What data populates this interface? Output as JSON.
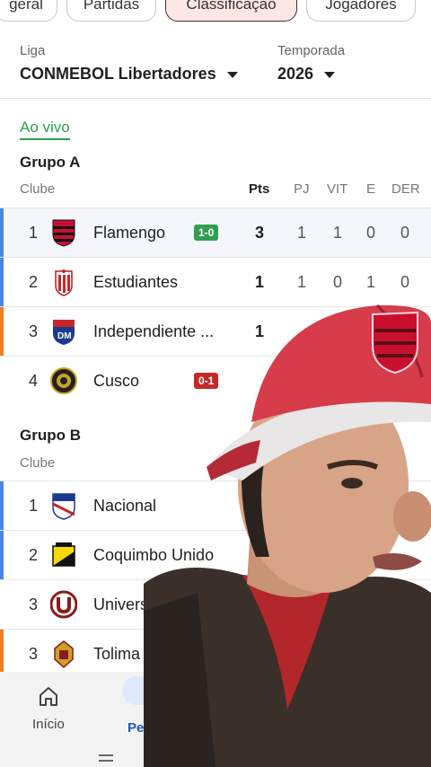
{
  "tabs": [
    {
      "label": "geral",
      "active": false
    },
    {
      "label": "Partidas",
      "active": false
    },
    {
      "label": "Classificação",
      "active": true
    },
    {
      "label": "Jogadores",
      "active": false
    }
  ],
  "filters": {
    "league_label": "Liga",
    "league_value": "CONMEBOL Libertadores",
    "season_label": "Temporada",
    "season_value": "2026"
  },
  "live_label": "Ao vivo",
  "columns": {
    "club": "Clube",
    "pts": "Pts",
    "pj": "PJ",
    "vit": "VIT",
    "e": "E",
    "der": "DER"
  },
  "groups": [
    {
      "title": "Grupo A",
      "rows": [
        {
          "pos": "1",
          "name": "Flamengo",
          "score": "1-0",
          "score_color": "#2e9f4e",
          "pts": "3",
          "pj": "1",
          "vit": "1",
          "e": "0",
          "der": "0",
          "bar": "#4a86e8"
        },
        {
          "pos": "2",
          "name": "Estudiantes",
          "score": "",
          "pts": "1",
          "pj": "1",
          "vit": "0",
          "e": "1",
          "der": "0",
          "bar": "#4a86e8"
        },
        {
          "pos": "3",
          "name": "Independiente ...",
          "score": "",
          "pts": "1",
          "pj": "",
          "vit": "",
          "e": "",
          "der": "",
          "bar": "#f07d22"
        },
        {
          "pos": "4",
          "name": "Cusco",
          "score": "0-1",
          "score_color": "#c62828",
          "pts": "",
          "pj": "",
          "vit": "",
          "e": "",
          "der": "",
          "bar": ""
        }
      ]
    },
    {
      "title": "Grupo B",
      "rows": [
        {
          "pos": "1",
          "name": "Nacional",
          "bar": "#4a86e8"
        },
        {
          "pos": "2",
          "name": "Coquimbo Unido",
          "bar": "#4a86e8"
        },
        {
          "pos": "3",
          "name": "Universita",
          "bar": ""
        },
        {
          "pos": "3",
          "name": "Tolima",
          "bar": "#f07d22"
        }
      ]
    }
  ],
  "bottom_nav": [
    {
      "label": "Início",
      "icon": "home-icon"
    },
    {
      "label": "Pe",
      "icon": "search-icon"
    }
  ],
  "colors": {
    "accent_live": "#2e9f4e",
    "active_chip": "#fde7e4",
    "blue_bar": "#4a86e8",
    "orange_bar": "#f07d22"
  }
}
